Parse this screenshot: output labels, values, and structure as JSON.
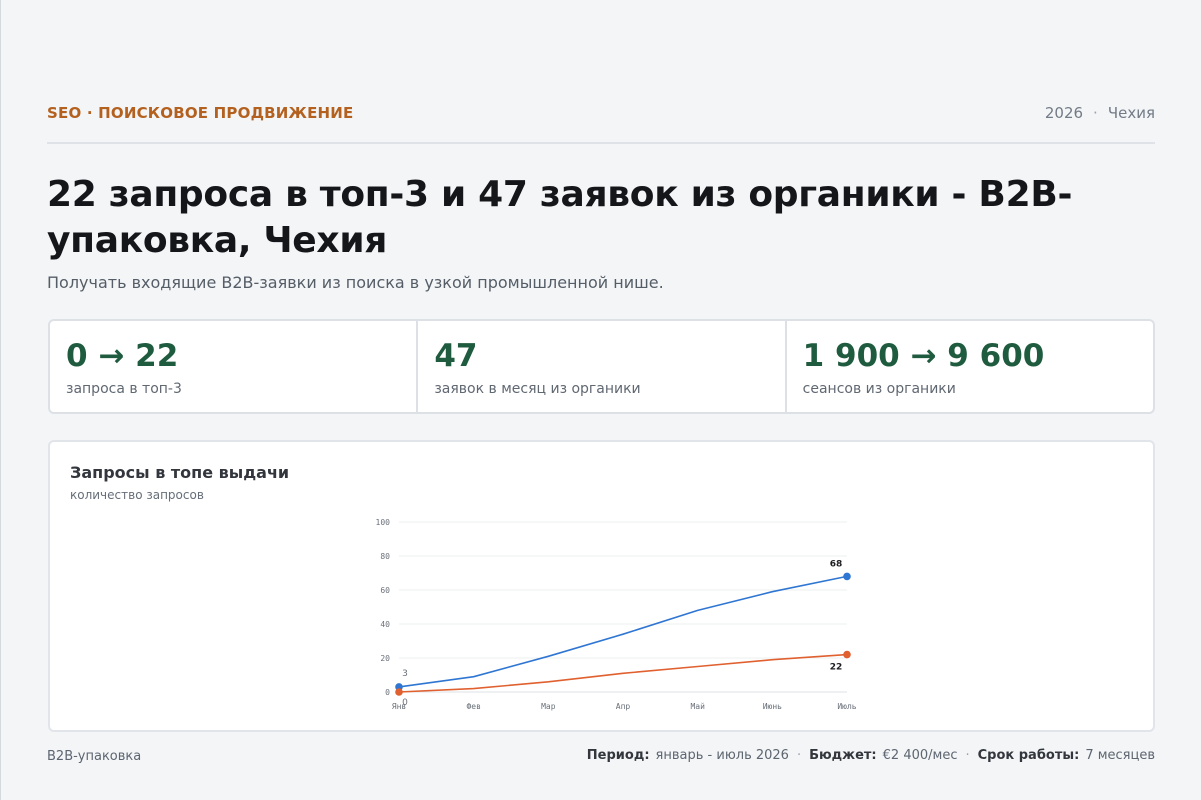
{
  "header": {
    "eyebrow": "SEO · ПОИСКОВОЕ ПРОДВИЖЕНИЕ",
    "year": "2026",
    "separator": "·",
    "country": "Чехия"
  },
  "title": "22 запроса в топ-3 и 47 заявок из органики - B2B-упаковка, Чехия",
  "subtitle": "Получать входящие B2B-заявки из поиска в узкой промышленной нише.",
  "stats": [
    {
      "value": "0 → 22",
      "label": "запроса в топ-3"
    },
    {
      "value": "47",
      "label": "заявок в месяц из органики"
    },
    {
      "value": "1 900 → 9 600",
      "label": "сеансов из органики"
    }
  ],
  "chart_card": {
    "title": "Запросы в топе выдачи",
    "subtitle": "количество запросов"
  },
  "chart_data": {
    "type": "line",
    "title": "Запросы в топе выдачи",
    "ylabel": "количество запросов",
    "categories": [
      "Янв",
      "Фев",
      "Мар",
      "Апр",
      "Май",
      "Июнь",
      "Июль"
    ],
    "ylim": [
      0,
      100
    ],
    "yticks": [
      0,
      20,
      40,
      60,
      80,
      100
    ],
    "grid": true,
    "series": [
      {
        "values": [
          3,
          9,
          21,
          34,
          48,
          59,
          68
        ],
        "color": "#2f76d2",
        "end_labels": [
          "3",
          "68"
        ]
      },
      {
        "values": [
          0,
          2,
          6,
          11,
          15,
          19,
          22
        ],
        "color": "#e0602f",
        "end_labels": [
          "0",
          "22"
        ]
      }
    ]
  },
  "footer": {
    "left": "B2B-упаковка",
    "period_label": "Период:",
    "period_value": "январь - июль 2026",
    "budget_label": "Бюджет:",
    "budget_value": "€2 400/мес",
    "term_label": "Срок работы:",
    "term_value": "7 месяцев",
    "separator": "·"
  }
}
